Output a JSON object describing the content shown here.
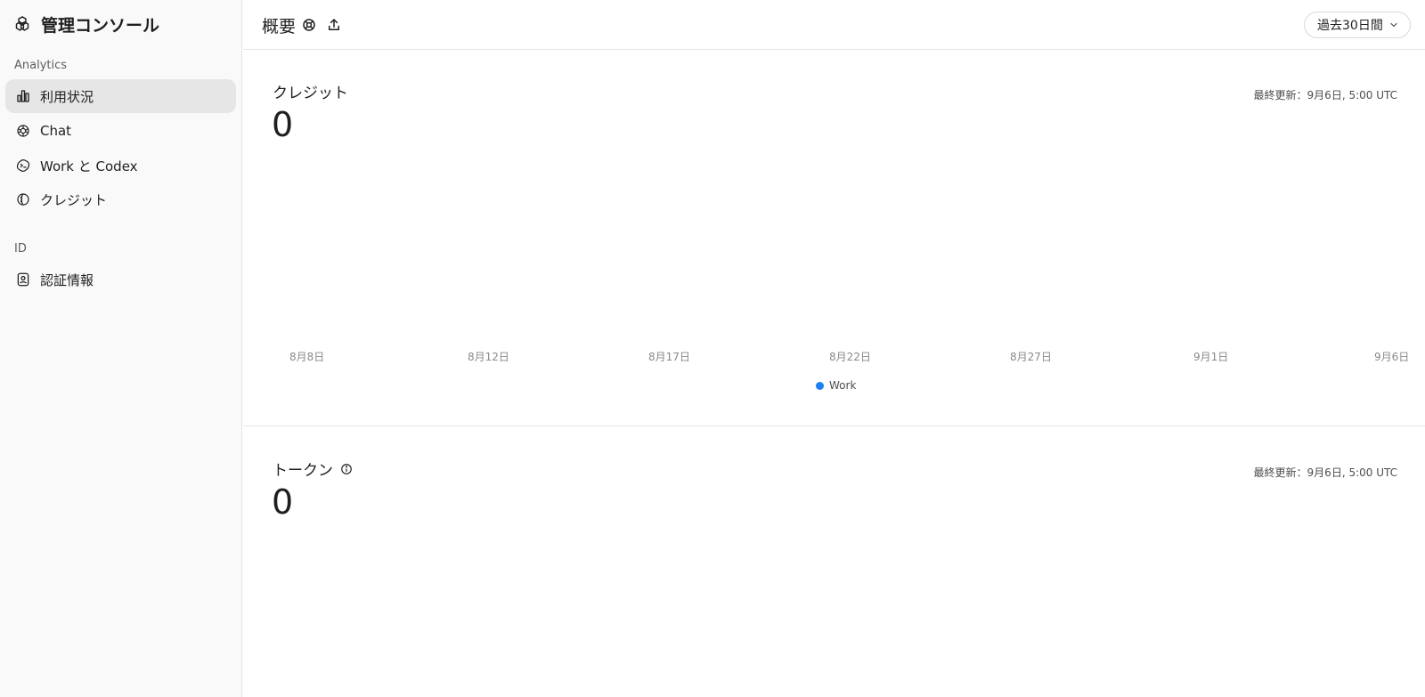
{
  "sidebar": {
    "brand": "管理コンソール",
    "sections": {
      "analytics": "Analytics",
      "id": "ID"
    },
    "items": [
      {
        "label": "利用状況",
        "icon": "bar-chart-icon",
        "active": true
      },
      {
        "label": "Chat",
        "icon": "openai-logo-icon",
        "active": false
      },
      {
        "label": "Work と Codex",
        "icon": "codex-icon",
        "active": false
      },
      {
        "label": "クレジット",
        "icon": "credit-icon",
        "active": false
      },
      {
        "label": "認証情報",
        "icon": "id-badge-icon",
        "active": false
      }
    ]
  },
  "header": {
    "title": "概要",
    "range_label": "過去30日間"
  },
  "cards": [
    {
      "title": "クレジット",
      "value": "0",
      "updated": "最終更新：9月6日, 5:00 UTC",
      "chart_data": {
        "type": "line",
        "x": [
          "8月8日",
          "8月12日",
          "8月17日",
          "8月22日",
          "8月27日",
          "9月1日",
          "9月6日"
        ],
        "series": [
          {
            "name": "Work",
            "values": [],
            "color": "#1a7ff0"
          }
        ]
      }
    },
    {
      "title": "トークン",
      "value": "0",
      "updated": "最終更新：9月6日, 5:00 UTC"
    }
  ],
  "colors": {
    "accent": "#1a7ff0",
    "sidebar_bg": "#f9f9f9",
    "active_bg": "#e6e6e6"
  }
}
